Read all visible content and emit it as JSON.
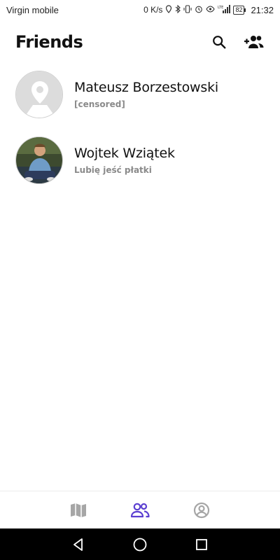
{
  "status_bar": {
    "carrier": "Virgin mobile",
    "net_speed": "0 K/s",
    "network_type": "LTE",
    "battery": "82",
    "time": "21:32"
  },
  "header": {
    "title": "Friends",
    "search_icon": "search-icon",
    "add_friend_icon": "add-friend-icon"
  },
  "friends": [
    {
      "name": "Mateusz Borzestowski",
      "status": "[censored]",
      "avatar": "placeholder-location-avatar"
    },
    {
      "name": "Wojtek Wziątek",
      "status": "Lubię jeść płatki",
      "avatar": "photo-avatar"
    }
  ],
  "bottom_nav": {
    "tabs": [
      "map-icon",
      "friends-icon",
      "profile-icon"
    ],
    "active_tab": "friends-icon",
    "active_color": "#5b3fd1",
    "inactive_color": "#a6a6a6"
  },
  "system_nav": [
    "back-icon",
    "home-icon",
    "recents-icon"
  ]
}
